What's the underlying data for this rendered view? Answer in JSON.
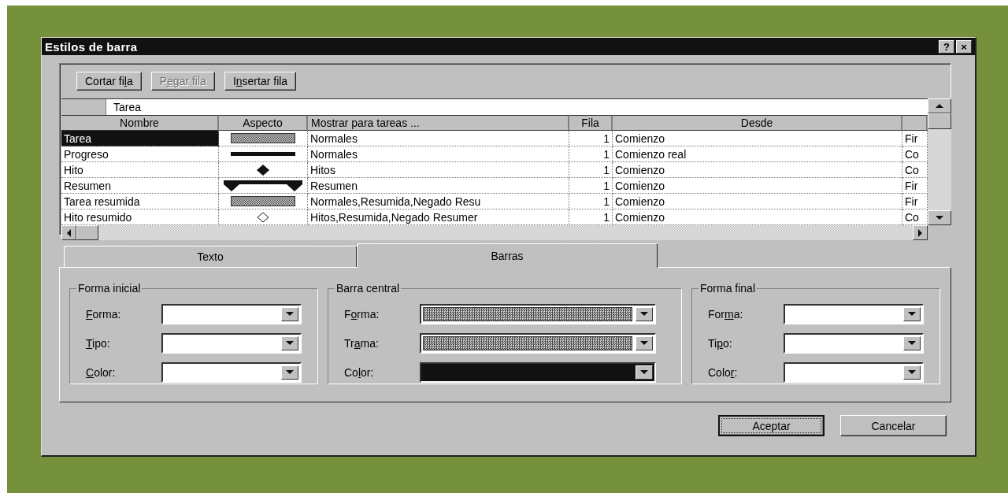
{
  "window": {
    "title": "Estilos de barra",
    "buttons": [
      "?",
      "×"
    ]
  },
  "toolbar": [
    {
      "label": {
        "before": "Cortar fi",
        "key": "l",
        "after": "a"
      },
      "disabled": false
    },
    {
      "label": {
        "before": "P",
        "key": "e",
        "after": "gar fila"
      },
      "disabled": true
    },
    {
      "label": {
        "before": "I",
        "key": "n",
        "after": "sertar fila"
      },
      "disabled": false
    }
  ],
  "edit_field": {
    "value": "Tarea"
  },
  "table": {
    "columns": [
      "Nombre",
      "Aspecto",
      "Mostrar para tareas ...",
      "Fila",
      "Desde"
    ],
    "rows": [
      {
        "name": "Tarea",
        "aspect": {
          "kind": "hatched"
        },
        "show": "Normales",
        "row": "1",
        "from": "Comienzo",
        "column_6": "Fir",
        "selected": true
      },
      {
        "name": "Progreso",
        "aspect": {
          "kind": "line"
        },
        "show": "Normales",
        "row": "1",
        "from": "Comienzo real",
        "column_6": "Co",
        "selected": false
      },
      {
        "name": "Hito",
        "aspect": {
          "kind": "diamond"
        },
        "show": "Hitos",
        "row": "1",
        "from": "Comienzo",
        "column_6": "Co",
        "selected": false
      },
      {
        "name": "Resumen",
        "aspect": {
          "kind": "summary"
        },
        "show": "Resumen",
        "row": "1",
        "from": "Comienzo",
        "column_6": "Fir",
        "selected": false
      },
      {
        "name": "Tarea resumida",
        "aspect": {
          "kind": "hatched"
        },
        "show": "Normales,Resumida,Negado Resu",
        "row": "1",
        "from": "Comienzo",
        "column_6": "Fir",
        "selected": false
      },
      {
        "name": "Hito resumido",
        "aspect": {
          "kind": "hollow"
        },
        "show": "Hitos,Resumida,Negado Resumer",
        "row": "1",
        "from": "Comienzo",
        "column_6": "Co",
        "selected": false
      }
    ]
  },
  "tabs": [
    {
      "label": "Texto",
      "selected": false
    },
    {
      "label": "Barras",
      "selected": true
    }
  ],
  "groups": [
    {
      "title": "Forma inicial",
      "fields": [
        {
          "label": {
            "key": "F",
            "after": "orma:"
          },
          "kind": "empty"
        },
        {
          "label": {
            "key": "T",
            "after": "ipo:"
          },
          "kind": "empty"
        },
        {
          "label": {
            "key": "C",
            "after": "olor:"
          },
          "kind": "empty"
        }
      ]
    },
    {
      "title": "Barra central",
      "fields": [
        {
          "label": {
            "before": "F",
            "key": "o",
            "after": "rma:"
          },
          "kind": "hatched"
        },
        {
          "label": {
            "before": "Tr",
            "key": "a",
            "after": "ma:"
          },
          "kind": "hatched"
        },
        {
          "label": {
            "before": "Co",
            "key": "l",
            "after": "or:"
          },
          "kind": "black"
        }
      ]
    },
    {
      "title": "Forma final",
      "fields": [
        {
          "label": {
            "before": "For",
            "key": "m",
            "after": "a:"
          },
          "kind": "empty"
        },
        {
          "label": {
            "before": "Ti",
            "key": "p",
            "after": "o:"
          },
          "kind": "empty"
        },
        {
          "label": {
            "before": "Colo",
            "key": "r",
            "after": ":"
          },
          "kind": "empty"
        }
      ]
    }
  ],
  "buttons": [
    {
      "label": "Aceptar",
      "default": true
    },
    {
      "label": "Cancelar",
      "default": false
    }
  ]
}
